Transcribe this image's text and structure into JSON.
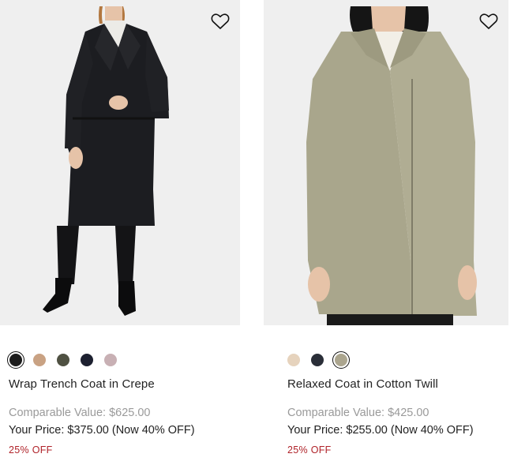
{
  "products": [
    {
      "name": "Wrap Trench Coat in Crepe",
      "comparable_value": "Comparable Value: $625.00",
      "your_price": "Your Price: $375.00 (Now 40% OFF)",
      "discount_badge": "25% OFF",
      "image_icon": "product-photo-black-trench",
      "wishlist_icon": "heart-outline-icon",
      "swatches": [
        {
          "color": "#1c1c1c",
          "selected": true
        },
        {
          "color": "#c9a283",
          "selected": false
        },
        {
          "color": "#4f5142",
          "selected": false
        },
        {
          "color": "#1d2030",
          "selected": false
        },
        {
          "color": "#c8b0b4",
          "selected": false
        }
      ]
    },
    {
      "name": "Relaxed Coat in Cotton Twill",
      "comparable_value": "Comparable Value: $425.00",
      "your_price": "Your Price: $255.00 (Now 40% OFF)",
      "discount_badge": "25% OFF",
      "image_icon": "product-photo-khaki-coat",
      "wishlist_icon": "heart-outline-icon",
      "swatches": [
        {
          "color": "#e6d3bd",
          "selected": false
        },
        {
          "color": "#2a2e38",
          "selected": false
        },
        {
          "color": "#aba58e",
          "selected": true
        }
      ]
    }
  ],
  "colors": {
    "image_background": "#efefef",
    "comparable_text": "#9a9a9a",
    "discount_text": "#b0232a"
  }
}
